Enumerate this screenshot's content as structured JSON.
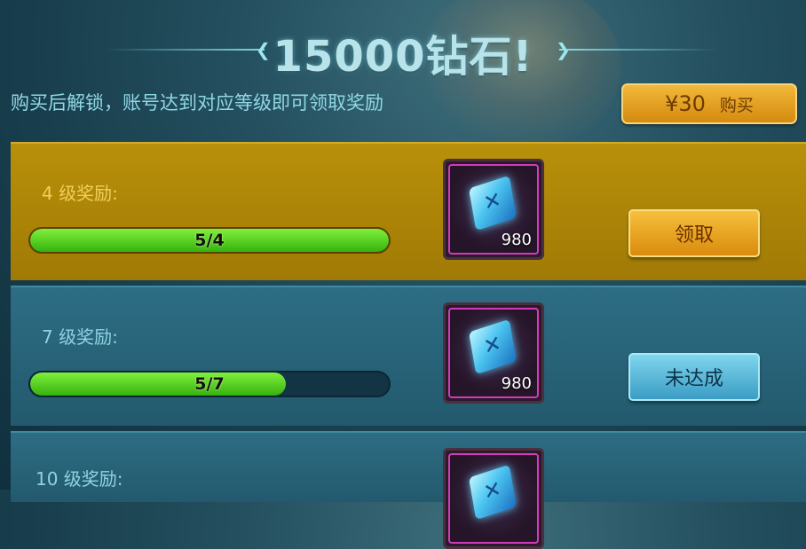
{
  "header": {
    "title": "15000钻石!",
    "subtitle": "购买后解锁，账号达到对应等级即可领取奖励",
    "buy_button": {
      "price": "¥30",
      "label": "购买"
    }
  },
  "rewards": [
    {
      "level_label": "4 级奖励:",
      "progress_text": "5/4",
      "progress_fraction": 1.0,
      "item": {
        "icon": "diamond-gem-icon",
        "quantity": "980"
      },
      "action_label": "领取",
      "state": "claimable"
    },
    {
      "level_label": "7 级奖励:",
      "progress_text": "5/7",
      "progress_fraction": 0.714,
      "item": {
        "icon": "diamond-gem-icon",
        "quantity": "980"
      },
      "action_label": "未达成",
      "state": "not-reached"
    },
    {
      "level_label": "10 级奖励:",
      "item": {
        "icon": "diamond-gem-icon"
      }
    }
  ],
  "colors": {
    "active_row": "#b8900a",
    "normal_row": "#2d6d84",
    "progress_fill": "#4fd01c",
    "gold_button": "#e8a41e",
    "blue_button": "#5ab9dc",
    "item_border": "#d13bb9"
  }
}
